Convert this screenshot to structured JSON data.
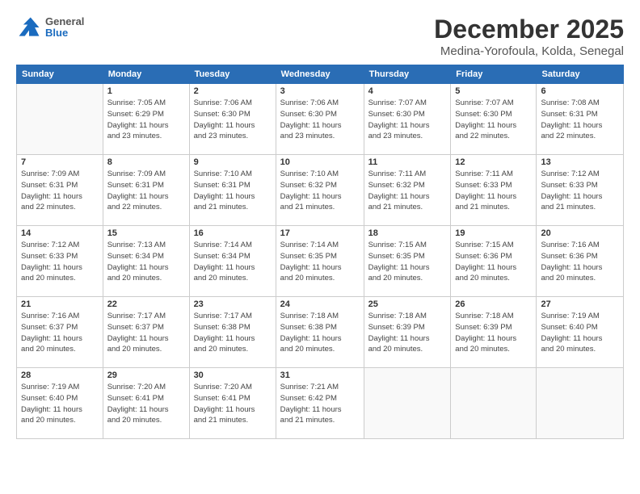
{
  "logo": {
    "general": "General",
    "blue": "Blue"
  },
  "title": "December 2025",
  "subtitle": "Medina-Yorofoula, Kolda, Senegal",
  "days_header": [
    "Sunday",
    "Monday",
    "Tuesday",
    "Wednesday",
    "Thursday",
    "Friday",
    "Saturday"
  ],
  "weeks": [
    [
      {
        "day": "",
        "info": ""
      },
      {
        "day": "1",
        "info": "Sunrise: 7:05 AM\nSunset: 6:29 PM\nDaylight: 11 hours\nand 23 minutes."
      },
      {
        "day": "2",
        "info": "Sunrise: 7:06 AM\nSunset: 6:30 PM\nDaylight: 11 hours\nand 23 minutes."
      },
      {
        "day": "3",
        "info": "Sunrise: 7:06 AM\nSunset: 6:30 PM\nDaylight: 11 hours\nand 23 minutes."
      },
      {
        "day": "4",
        "info": "Sunrise: 7:07 AM\nSunset: 6:30 PM\nDaylight: 11 hours\nand 23 minutes."
      },
      {
        "day": "5",
        "info": "Sunrise: 7:07 AM\nSunset: 6:30 PM\nDaylight: 11 hours\nand 22 minutes."
      },
      {
        "day": "6",
        "info": "Sunrise: 7:08 AM\nSunset: 6:31 PM\nDaylight: 11 hours\nand 22 minutes."
      }
    ],
    [
      {
        "day": "7",
        "info": "Sunrise: 7:09 AM\nSunset: 6:31 PM\nDaylight: 11 hours\nand 22 minutes."
      },
      {
        "day": "8",
        "info": "Sunrise: 7:09 AM\nSunset: 6:31 PM\nDaylight: 11 hours\nand 22 minutes."
      },
      {
        "day": "9",
        "info": "Sunrise: 7:10 AM\nSunset: 6:31 PM\nDaylight: 11 hours\nand 21 minutes."
      },
      {
        "day": "10",
        "info": "Sunrise: 7:10 AM\nSunset: 6:32 PM\nDaylight: 11 hours\nand 21 minutes."
      },
      {
        "day": "11",
        "info": "Sunrise: 7:11 AM\nSunset: 6:32 PM\nDaylight: 11 hours\nand 21 minutes."
      },
      {
        "day": "12",
        "info": "Sunrise: 7:11 AM\nSunset: 6:33 PM\nDaylight: 11 hours\nand 21 minutes."
      },
      {
        "day": "13",
        "info": "Sunrise: 7:12 AM\nSunset: 6:33 PM\nDaylight: 11 hours\nand 21 minutes."
      }
    ],
    [
      {
        "day": "14",
        "info": "Sunrise: 7:12 AM\nSunset: 6:33 PM\nDaylight: 11 hours\nand 20 minutes."
      },
      {
        "day": "15",
        "info": "Sunrise: 7:13 AM\nSunset: 6:34 PM\nDaylight: 11 hours\nand 20 minutes."
      },
      {
        "day": "16",
        "info": "Sunrise: 7:14 AM\nSunset: 6:34 PM\nDaylight: 11 hours\nand 20 minutes."
      },
      {
        "day": "17",
        "info": "Sunrise: 7:14 AM\nSunset: 6:35 PM\nDaylight: 11 hours\nand 20 minutes."
      },
      {
        "day": "18",
        "info": "Sunrise: 7:15 AM\nSunset: 6:35 PM\nDaylight: 11 hours\nand 20 minutes."
      },
      {
        "day": "19",
        "info": "Sunrise: 7:15 AM\nSunset: 6:36 PM\nDaylight: 11 hours\nand 20 minutes."
      },
      {
        "day": "20",
        "info": "Sunrise: 7:16 AM\nSunset: 6:36 PM\nDaylight: 11 hours\nand 20 minutes."
      }
    ],
    [
      {
        "day": "21",
        "info": "Sunrise: 7:16 AM\nSunset: 6:37 PM\nDaylight: 11 hours\nand 20 minutes."
      },
      {
        "day": "22",
        "info": "Sunrise: 7:17 AM\nSunset: 6:37 PM\nDaylight: 11 hours\nand 20 minutes."
      },
      {
        "day": "23",
        "info": "Sunrise: 7:17 AM\nSunset: 6:38 PM\nDaylight: 11 hours\nand 20 minutes."
      },
      {
        "day": "24",
        "info": "Sunrise: 7:18 AM\nSunset: 6:38 PM\nDaylight: 11 hours\nand 20 minutes."
      },
      {
        "day": "25",
        "info": "Sunrise: 7:18 AM\nSunset: 6:39 PM\nDaylight: 11 hours\nand 20 minutes."
      },
      {
        "day": "26",
        "info": "Sunrise: 7:18 AM\nSunset: 6:39 PM\nDaylight: 11 hours\nand 20 minutes."
      },
      {
        "day": "27",
        "info": "Sunrise: 7:19 AM\nSunset: 6:40 PM\nDaylight: 11 hours\nand 20 minutes."
      }
    ],
    [
      {
        "day": "28",
        "info": "Sunrise: 7:19 AM\nSunset: 6:40 PM\nDaylight: 11 hours\nand 20 minutes."
      },
      {
        "day": "29",
        "info": "Sunrise: 7:20 AM\nSunset: 6:41 PM\nDaylight: 11 hours\nand 20 minutes."
      },
      {
        "day": "30",
        "info": "Sunrise: 7:20 AM\nSunset: 6:41 PM\nDaylight: 11 hours\nand 21 minutes."
      },
      {
        "day": "31",
        "info": "Sunrise: 7:21 AM\nSunset: 6:42 PM\nDaylight: 11 hours\nand 21 minutes."
      },
      {
        "day": "",
        "info": ""
      },
      {
        "day": "",
        "info": ""
      },
      {
        "day": "",
        "info": ""
      }
    ]
  ]
}
